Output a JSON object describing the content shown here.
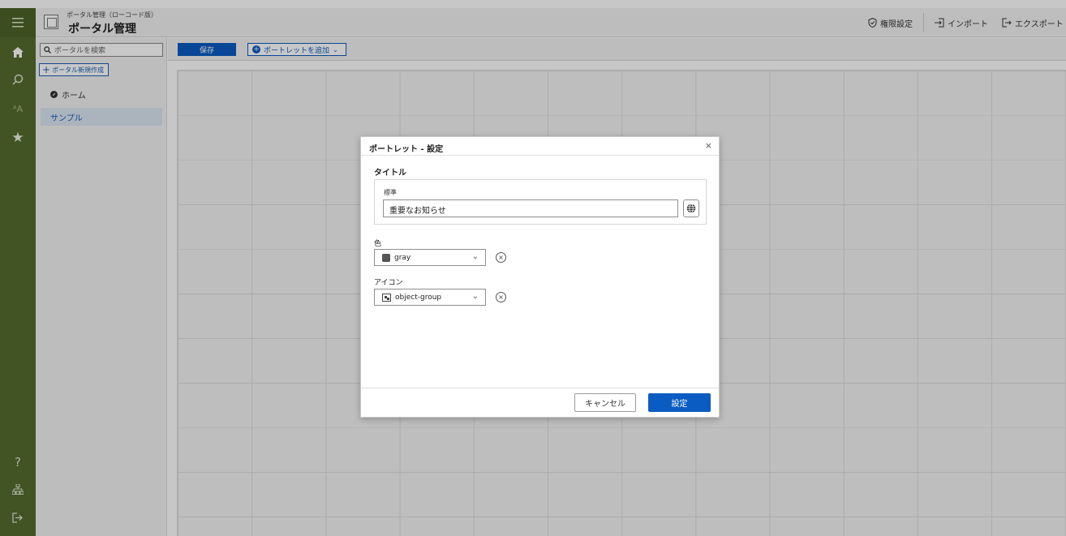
{
  "header": {
    "subtitle": "ポータル管理（ローコード版）",
    "title": "ポータル管理",
    "actions": {
      "permissions": "権限設定",
      "import": "インポート",
      "export": "エクスポート"
    }
  },
  "sidebar": {
    "search_placeholder": "ポータルを検索",
    "new_button": "ポータル新規作成",
    "items": [
      {
        "label": "ホーム"
      },
      {
        "label": "サンプル"
      }
    ]
  },
  "toolbar": {
    "save_label": "保存",
    "add_portlet_label": "ポートレットを追加"
  },
  "rail": {
    "icons": [
      "menu-icon",
      "home-icon",
      "search-icon",
      "font-icon",
      "star-icon",
      "help-icon",
      "sitemap-icon",
      "logout-icon"
    ],
    "help_glyph": "?"
  },
  "dialog": {
    "title": "ポートレット - 設定",
    "close_glyph": "×",
    "title_section": "タイトル",
    "standard_label": "標準",
    "title_value": "重要なお知らせ",
    "color_label": "色",
    "color_value": "gray",
    "icon_label": "アイコン",
    "icon_value": "object-group",
    "cancel_label": "キャンセル",
    "ok_label": "設定"
  }
}
